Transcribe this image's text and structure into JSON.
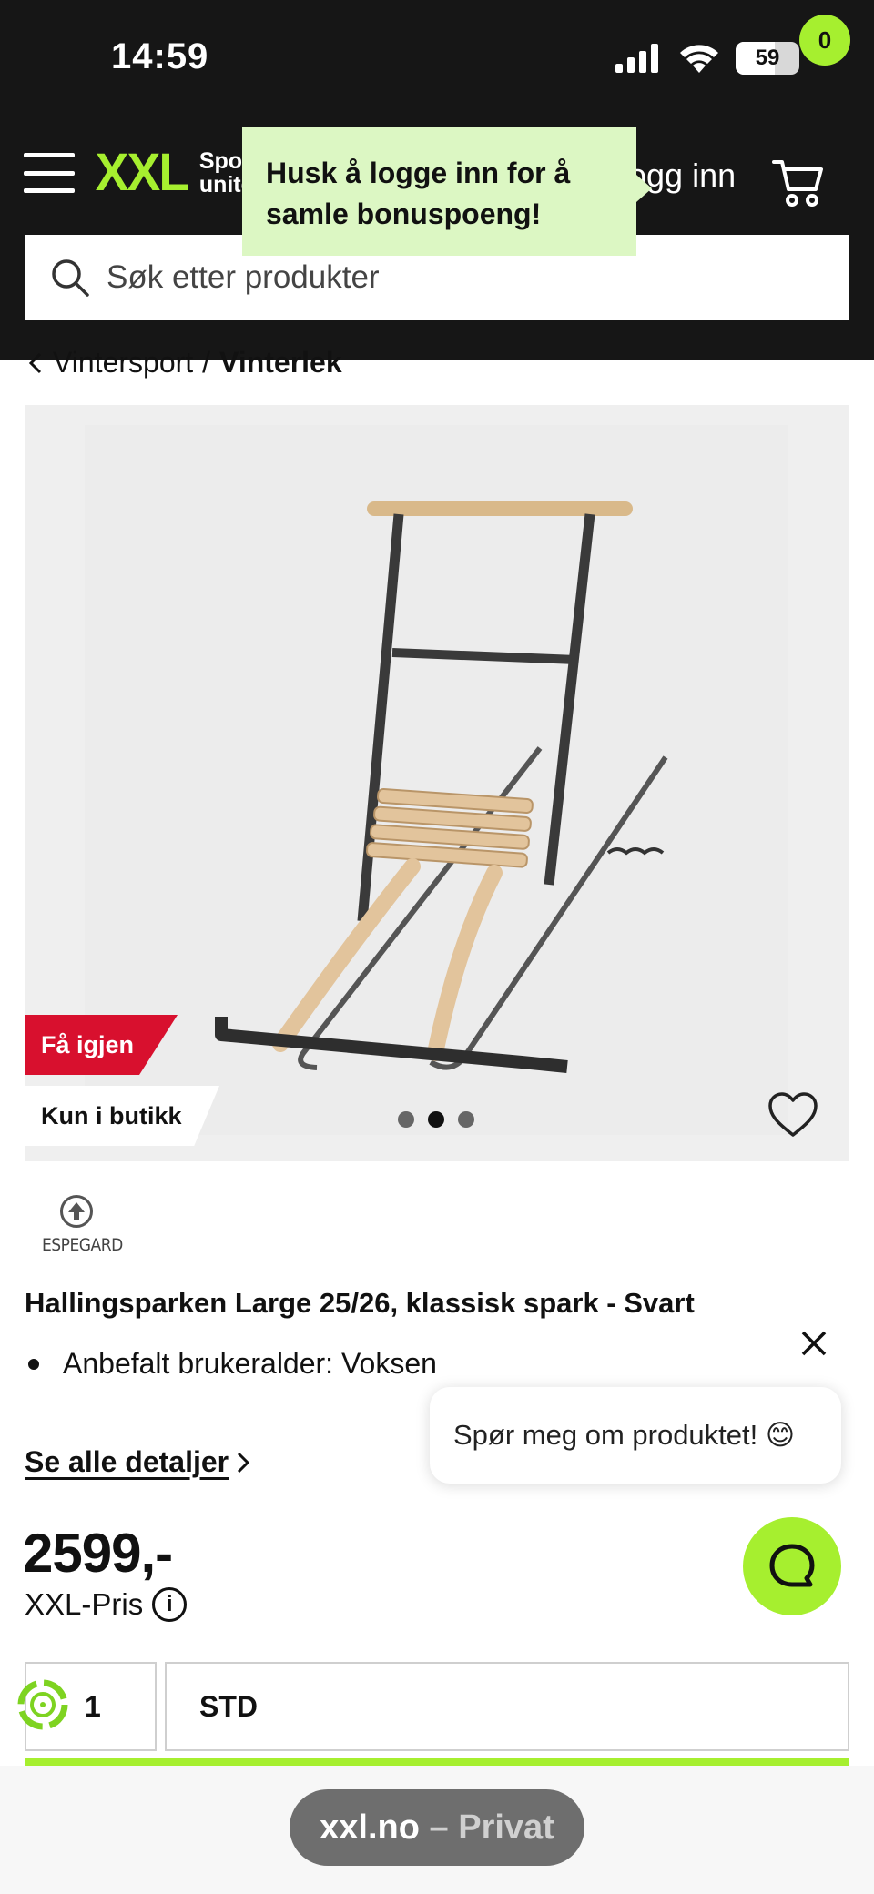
{
  "status_bar": {
    "time": "14:59",
    "battery": "59"
  },
  "header": {
    "logo_text": "XXL",
    "logo_tagline_1": "Spor",
    "logo_tagline_2": "unite",
    "login_label": "ogg inn",
    "cart_count": "0",
    "search_placeholder": "Søk etter produkter",
    "tooltip_line_1": "Husk å logge inn for å",
    "tooltip_line_2": "samle bonuspoeng!"
  },
  "breadcrumb": {
    "parent": "Vintersport",
    "separator": "/",
    "current": "Vinterlek"
  },
  "product": {
    "badge_restock": "Få igjen",
    "badge_store_only": "Kun i butikk",
    "image_count": 3,
    "active_image": 2,
    "brand": "ESPEGARD",
    "title": "Hallingsparken Large 25/26, klassisk spark - Svart",
    "bullet": "Anbefalt brukeralder: Voksen",
    "details_link": "Se alle detaljer",
    "price": "2599,-",
    "price_label": "XXL-Pris",
    "quantity": "1",
    "size": "STD"
  },
  "chat": {
    "prompt": "Spør meg om produktet! 😊"
  },
  "browser": {
    "domain": "xxl.no",
    "dash": "–",
    "mode": "Privat"
  },
  "colors": {
    "brand_green": "#a6ef2f",
    "header_dark": "#161616",
    "badge_red": "#d8102e",
    "tooltip_green": "#dcf7c3"
  }
}
